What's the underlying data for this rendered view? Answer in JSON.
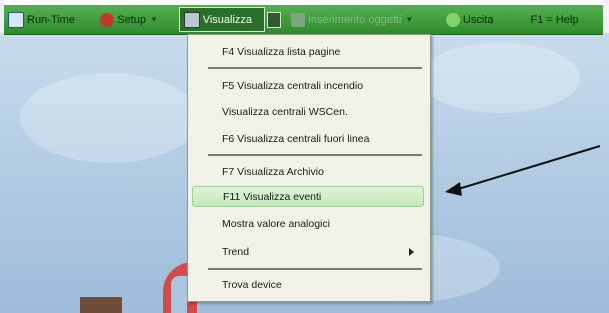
{
  "toolbar": {
    "items": [
      {
        "label": "Run-Time",
        "icon": "computer-icon"
      },
      {
        "label": "Setup",
        "icon": "setup-icon"
      },
      {
        "label": "Visualizza",
        "icon": "view-icon"
      },
      {
        "label": "Inserimento oggetti",
        "icon": "insert-objects-icon"
      },
      {
        "label": "Uscita",
        "icon": "exit-icon"
      },
      {
        "label": "F1 = Help"
      }
    ]
  },
  "menu": {
    "items": [
      {
        "label": "F4 Visualizza lista pagine"
      },
      {
        "label": "F5 Visualizza centrali incendio"
      },
      {
        "label": "Visualizza centrali WSCen."
      },
      {
        "label": "F6 Visualizza centrali fuori linea"
      },
      {
        "label": "F7 Visualizza Archivio"
      },
      {
        "label": "F11 Visualizza eventi"
      },
      {
        "label": "Mostra valore analogici"
      },
      {
        "label": "Trend"
      },
      {
        "label": "Trova device"
      }
    ]
  },
  "colors": {
    "toolbar": "#3b9b37",
    "menu_bg": "#f2f2e9",
    "highlight": "#c4e9bc"
  }
}
